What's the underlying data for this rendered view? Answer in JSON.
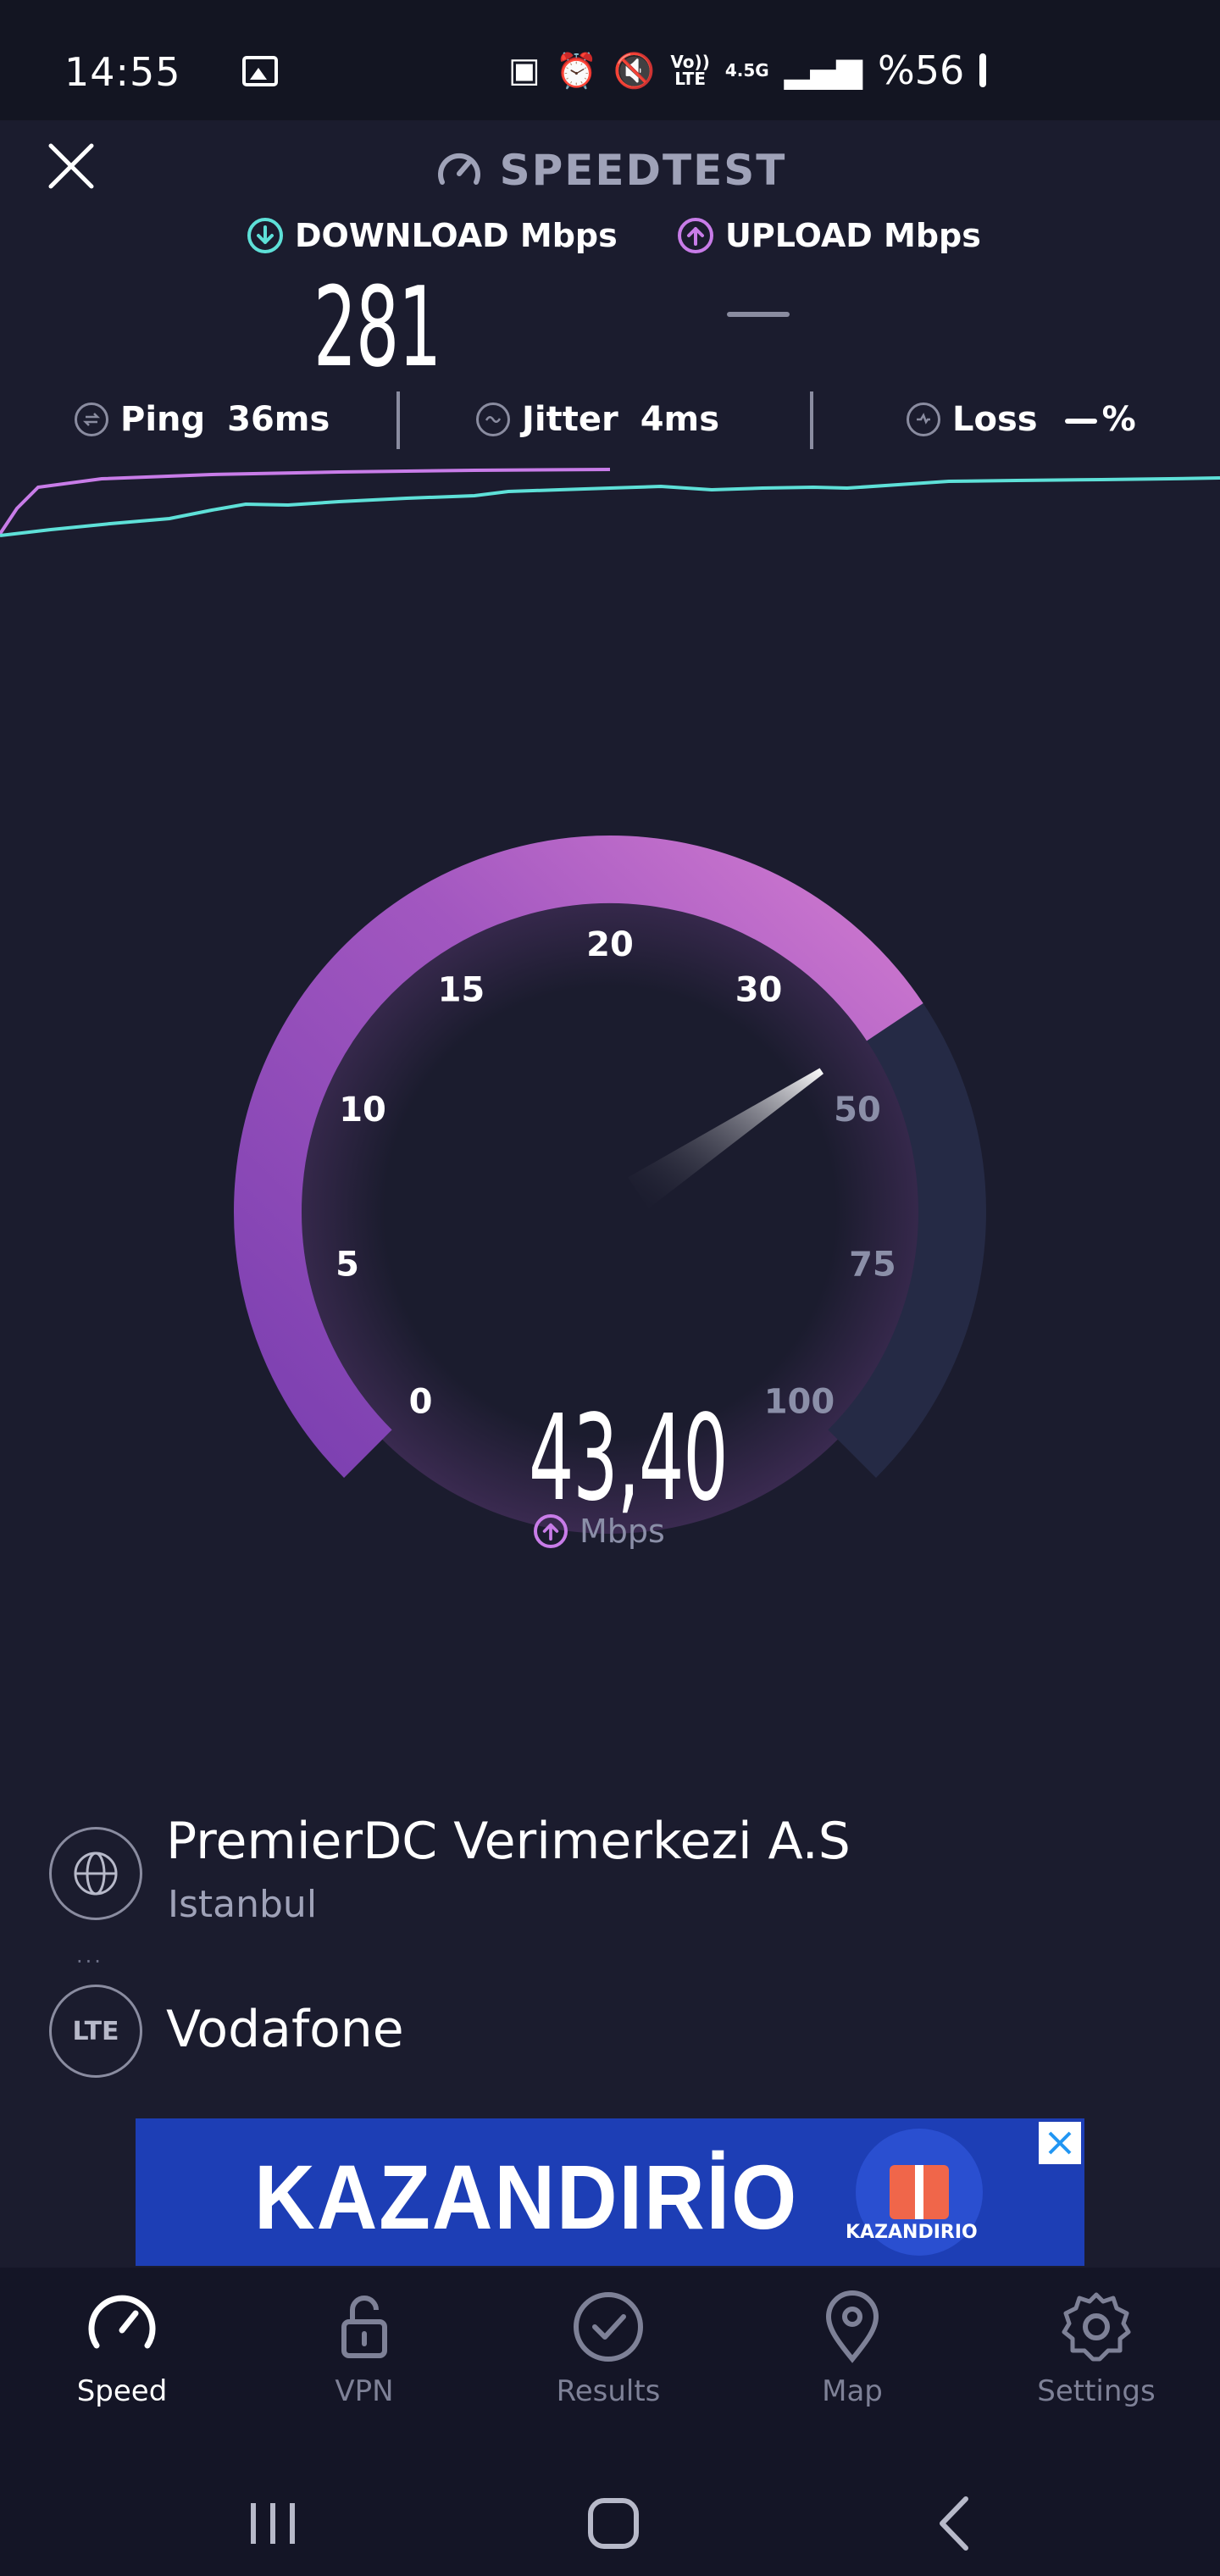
{
  "status_bar": {
    "time": "14:55",
    "battery": "%56",
    "network": "4.5G",
    "volte": "Vo))\nLTE"
  },
  "header": {
    "title": "SPEEDTEST"
  },
  "download": {
    "label": "DOWNLOAD Mbps",
    "value": "281"
  },
  "upload": {
    "label": "UPLOAD Mbps",
    "value": "—"
  },
  "stats": {
    "ping_label": "Ping",
    "ping_value": "36ms",
    "jitter_label": "Jitter",
    "jitter_value": "4ms",
    "loss_label": "Loss",
    "loss_value": "%"
  },
  "gauge": {
    "labels": [
      "0",
      "5",
      "10",
      "15",
      "20",
      "30",
      "50",
      "75",
      "100"
    ],
    "value": "43,40",
    "value_number": 43.4,
    "unit": "Mbps",
    "fill_color": "#b15fc6",
    "track_color": "#252a45"
  },
  "server": {
    "name": "PremierDC Verimerkezi A.S",
    "city": "Istanbul"
  },
  "carrier": {
    "icon_text": "LTE",
    "name": "Vodafone"
  },
  "ad": {
    "text": "KAZANDIRİO",
    "logo_text": "KAZANDIRIO"
  },
  "nav": {
    "speed": "Speed",
    "vpn": "VPN",
    "results": "Results",
    "map": "Map",
    "settings": "Settings"
  },
  "colors": {
    "download_accent": "#5ee0d8",
    "upload_accent": "#c87ce8",
    "background": "#1b1c2e"
  }
}
